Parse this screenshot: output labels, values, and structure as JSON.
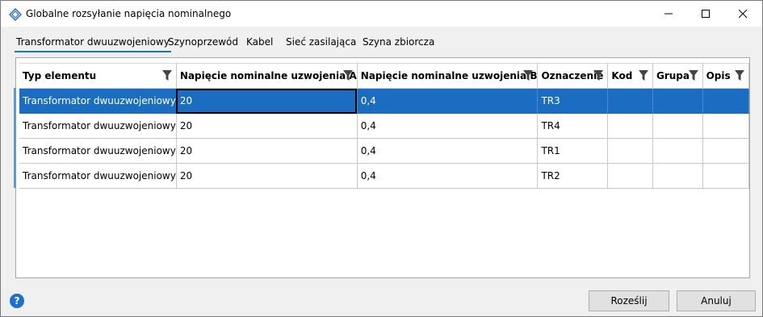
{
  "window": {
    "title": "Globalne rozsyłanie napięcia nominalnego"
  },
  "tabs": [
    {
      "label": "Transformator dwuuzwojeniowy",
      "active": true
    },
    {
      "label": "Szynoprzewód",
      "active": false
    },
    {
      "label": "Kabel",
      "active": false
    },
    {
      "label": "Sieć zasilająca",
      "active": false
    },
    {
      "label": "Szyna zbiorcza",
      "active": false
    }
  ],
  "grid": {
    "columns": [
      "Typ elementu",
      "Napięcie nominalne uzwojenia A",
      "Napięcie nominalne uzwojenia B",
      "Oznaczenie",
      "Kod",
      "Grupa",
      "Opis"
    ],
    "rows": [
      [
        "Transformator dwuuzwojeniowy",
        "20",
        "0,4",
        "TR3",
        "",
        "",
        ""
      ],
      [
        "Transformator dwuuzwojeniowy",
        "20",
        "0,4",
        "TR4",
        "",
        "",
        ""
      ],
      [
        "Transformator dwuuzwojeniowy",
        "20",
        "0,4",
        "TR1",
        "",
        "",
        ""
      ],
      [
        "Transformator dwuuzwojeniowy",
        "20",
        "0,4",
        "TR2",
        "",
        "",
        ""
      ]
    ],
    "selected_row": 0
  },
  "footer": {
    "help_label": "?",
    "send_label": "Roześlij",
    "cancel_label": "Anuluj"
  },
  "colors": {
    "selection": "#1a6dc1",
    "tab_underline": "#1a73c7",
    "help": "#1d6fd0"
  },
  "icons": {
    "app": "diamond-icon",
    "filter": "filter-icon",
    "help": "help-icon"
  }
}
